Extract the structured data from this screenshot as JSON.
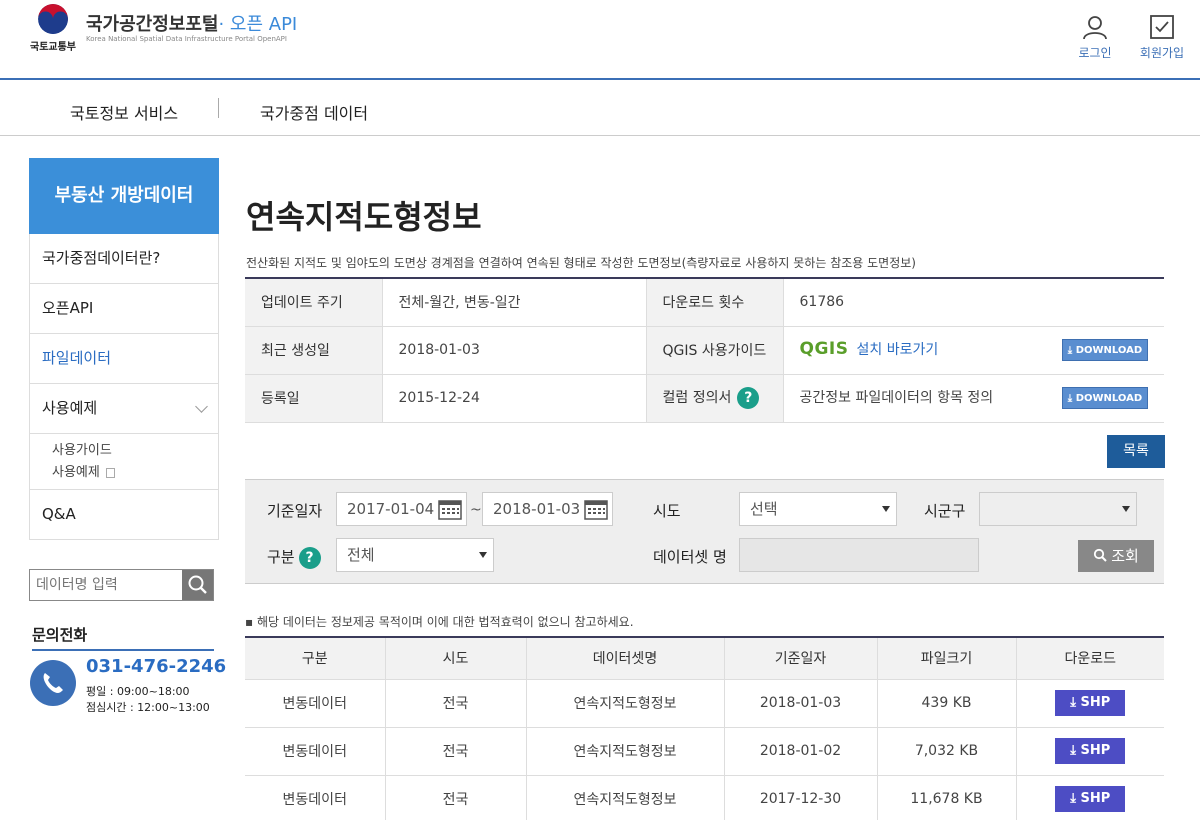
{
  "header": {
    "dept": "국토교통부",
    "title": "국가공간정보포털",
    "title_accent": "· 오픈 API",
    "subtitle": "Korea National Spatial Data Infrastructure Portal OpenAPI",
    "login": "로그인",
    "signup": "회원가입"
  },
  "topnav": {
    "items": [
      "국토정보 서비스",
      "국가중점 데이터"
    ]
  },
  "sidebar": {
    "head": "부동산 개방데이터",
    "items": [
      "국가중점데이터란?",
      "오픈API",
      "파일데이터",
      "사용예제",
      "Q&A"
    ],
    "subitems": [
      "사용가이드",
      "사용예제"
    ],
    "search_placeholder": "데이터명 입력",
    "contact_title": "문의전화",
    "phone": "031-476-2246",
    "hours_weekday": "평일 : 09:00~18:00",
    "hours_lunch": "점심시간 : 12:00~13:00"
  },
  "content": {
    "title": "연속지적도형정보",
    "desc": "전산화된 지적도 및 임야도의 도면상 경계점을 연결하여 연속된 형태로 작성한 도면정보(측량자료로 사용하지 못하는 참조용 도면정보)",
    "info": {
      "update_label": "업데이트 주기",
      "update_value": "전체-월간, 변동-일간",
      "downloads_label": "다운로드 횟수",
      "downloads_value": "61786",
      "created_label": "최근 생성일",
      "created_value": "2018-01-03",
      "qgis_label": "QGIS 사용가이드",
      "qgis_logo": "QGIS",
      "qgis_link": "설치 바로가기",
      "registered_label": "등록일",
      "registered_value": "2015-12-24",
      "columns_label": "컬럼 정의서",
      "columns_value": "공간정보 파일데이터의 항목 정의",
      "download_btn": "DOWNLOAD",
      "help": "?"
    },
    "list_btn": "목록"
  },
  "filter": {
    "date_label": "기준일자",
    "date_from": "2017-01-04",
    "date_to": "2018-01-03",
    "tilde": "~",
    "sido_label": "시도",
    "sido_value": "선택",
    "sigungu_label": "시군구",
    "sigungu_value": "",
    "type_label": "구분",
    "type_value": "전체",
    "dataset_label": "데이터셋 명",
    "dataset_value": "",
    "query_btn": "조회"
  },
  "notice": "▪ 해당 데이터는 정보제공 목적이며 이에 대한 법적효력이 없으니 참고하세요.",
  "table": {
    "headers": [
      "구분",
      "시도",
      "데이터셋명",
      "기준일자",
      "파일크기",
      "다운로드"
    ],
    "rows": [
      [
        "변동데이터",
        "전국",
        "연속지적도형정보",
        "2018-01-03",
        "439 KB",
        "SHP"
      ],
      [
        "변동데이터",
        "전국",
        "연속지적도형정보",
        "2018-01-02",
        "7,032 KB",
        "SHP"
      ],
      [
        "변동데이터",
        "전국",
        "연속지적도형정보",
        "2017-12-30",
        "11,678 KB",
        "SHP"
      ]
    ]
  }
}
